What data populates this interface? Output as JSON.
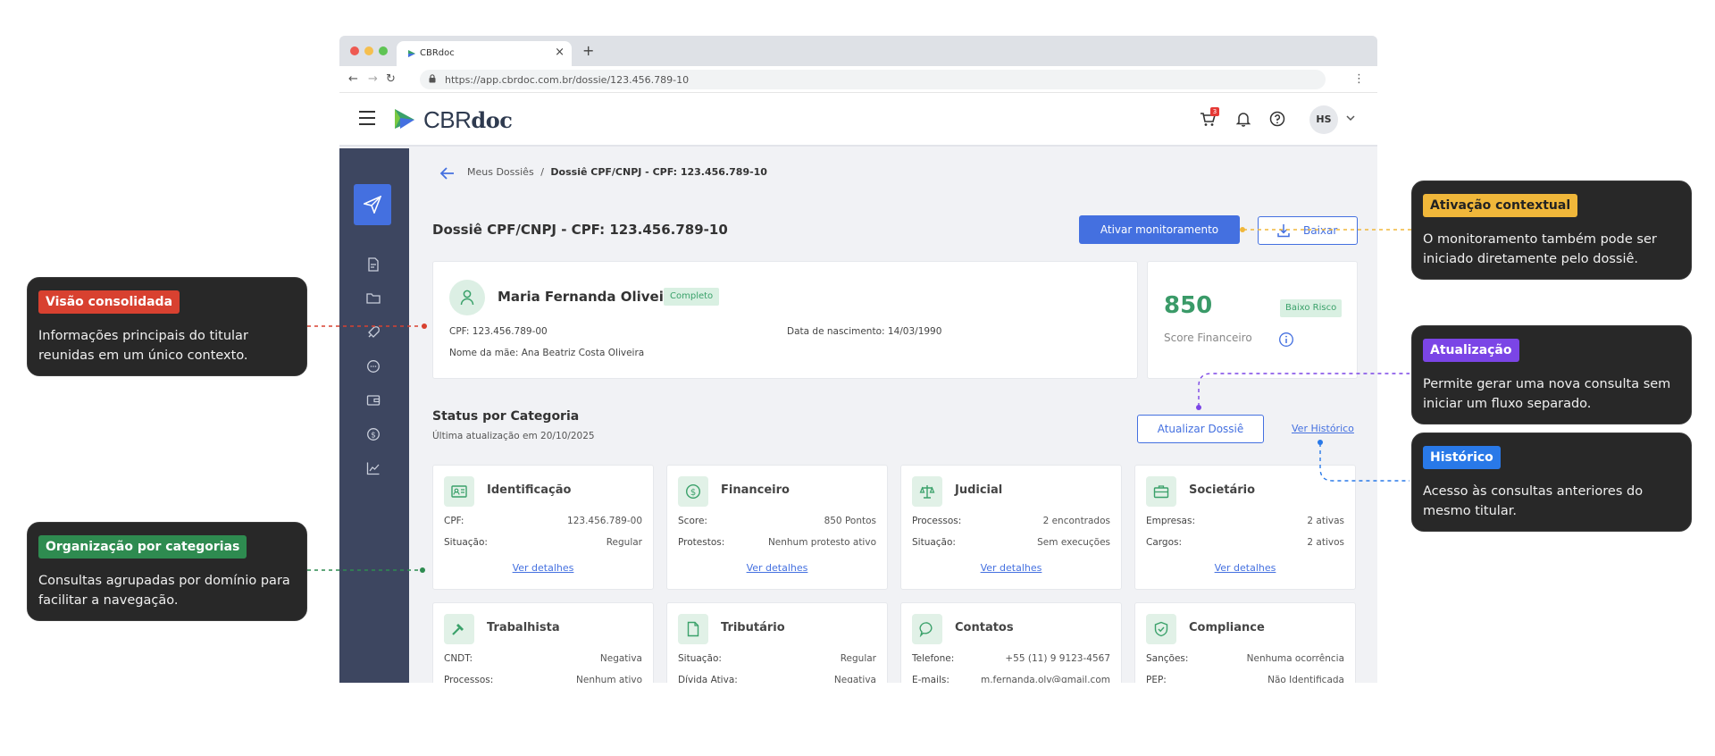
{
  "colors": {
    "brand_blue": "#4470e0",
    "sidebar": "#3d4660",
    "success_green": "#3aa16a",
    "tag_red": "#d84130",
    "tag_green": "#2e8b50",
    "tag_yellow": "#f0b73a",
    "tag_purple": "#7b45e6",
    "tag_blue": "#2979e8"
  },
  "browser": {
    "tab_title": "CBRdoc",
    "url": "https://app.cbrdoc.com.br/dossie/123.456.789-10"
  },
  "header": {
    "logo_part1": "CBR",
    "logo_part2": "doc",
    "cart_count": "3",
    "avatar_initials": "HS"
  },
  "breadcrumb": {
    "parent": "Meus Dossiês",
    "separator": "/",
    "current": "Dossiê CPF/CNPJ - CPF: 123.456.789-10"
  },
  "page": {
    "title": "Dossiê CPF/CNPJ - CPF: 123.456.789-10",
    "btn_monitor": "Ativar monitoramento",
    "btn_download": "Baixar"
  },
  "profile": {
    "name": "Maria Fernanda Oliveira",
    "status": "Completo",
    "cpf_label": "CPF:",
    "cpf_value": "123.456.789-00",
    "birth_label": "Data de nascimento:",
    "birth_value": "14/03/1990",
    "mother_label": "Nome da mãe:",
    "mother_value": "Ana Beatriz Costa Oliveira"
  },
  "score": {
    "value": "850",
    "risk": "Baixo Risco",
    "label": "Score Financeiro"
  },
  "status_section": {
    "title": "Status por Categoria",
    "subtitle": "Última atualização em 20/10/2025",
    "btn_update": "Atualizar Dossiê",
    "link_history": "Ver Histórico",
    "details_link": "Ver detalhes"
  },
  "categories": [
    {
      "title": "Identificação",
      "icon": "id-card-icon",
      "rows": [
        {
          "k": "CPF:",
          "v": "123.456.789-00"
        },
        {
          "k": "Situação:",
          "v": "Regular"
        }
      ]
    },
    {
      "title": "Financeiro",
      "icon": "dollar-icon",
      "rows": [
        {
          "k": "Score:",
          "v": "850 Pontos"
        },
        {
          "k": "Protestos:",
          "v": "Nenhum protesto ativo"
        }
      ]
    },
    {
      "title": "Judicial",
      "icon": "scale-icon",
      "rows": [
        {
          "k": "Processos:",
          "v": "2 encontrados"
        },
        {
          "k": "Situação:",
          "v": "Sem execuções"
        }
      ]
    },
    {
      "title": "Societário",
      "icon": "briefcase-icon",
      "rows": [
        {
          "k": "Empresas:",
          "v": "2 ativas"
        },
        {
          "k": "Cargos:",
          "v": "2 ativos"
        }
      ]
    },
    {
      "title": "Trabalhista",
      "icon": "hammer-icon",
      "rows": [
        {
          "k": "CNDT:",
          "v": "Negativa"
        },
        {
          "k": "Processos:",
          "v": "Nenhum ativo"
        }
      ]
    },
    {
      "title": "Tributário",
      "icon": "document-icon",
      "rows": [
        {
          "k": "Situação:",
          "v": "Regular"
        },
        {
          "k": "Dívida Ativa:",
          "v": "Negativa"
        }
      ]
    },
    {
      "title": "Contatos",
      "icon": "chat-icon",
      "rows": [
        {
          "k": "Telefone:",
          "v": "+55 (11) 9 9123-4567"
        },
        {
          "k": "E-mails:",
          "v": "m.fernanda.olv@gmail.com"
        }
      ]
    },
    {
      "title": "Compliance",
      "icon": "shield-check-icon",
      "rows": [
        {
          "k": "Sanções:",
          "v": "Nenhuma ocorrência"
        },
        {
          "k": "PEP:",
          "v": "Não Identificada"
        }
      ]
    }
  ],
  "callouts": {
    "consolidated": {
      "tag": "Visão consolidada",
      "text": "Informações principais do titular reunidas em um único contexto."
    },
    "categories": {
      "tag": "Organização por categorias",
      "text": "Consultas agrupadas por domínio para facilitar a navegação."
    },
    "activation": {
      "tag": "Ativação contextual",
      "text": "O monitoramento também pode ser iniciado diretamente pelo dossiê."
    },
    "update": {
      "tag": "Atualização",
      "text": "Permite gerar uma nova consulta sem iniciar um fluxo separado."
    },
    "history": {
      "tag": "Histórico",
      "text": "Acesso às consultas anteriores do mesmo titular."
    }
  }
}
